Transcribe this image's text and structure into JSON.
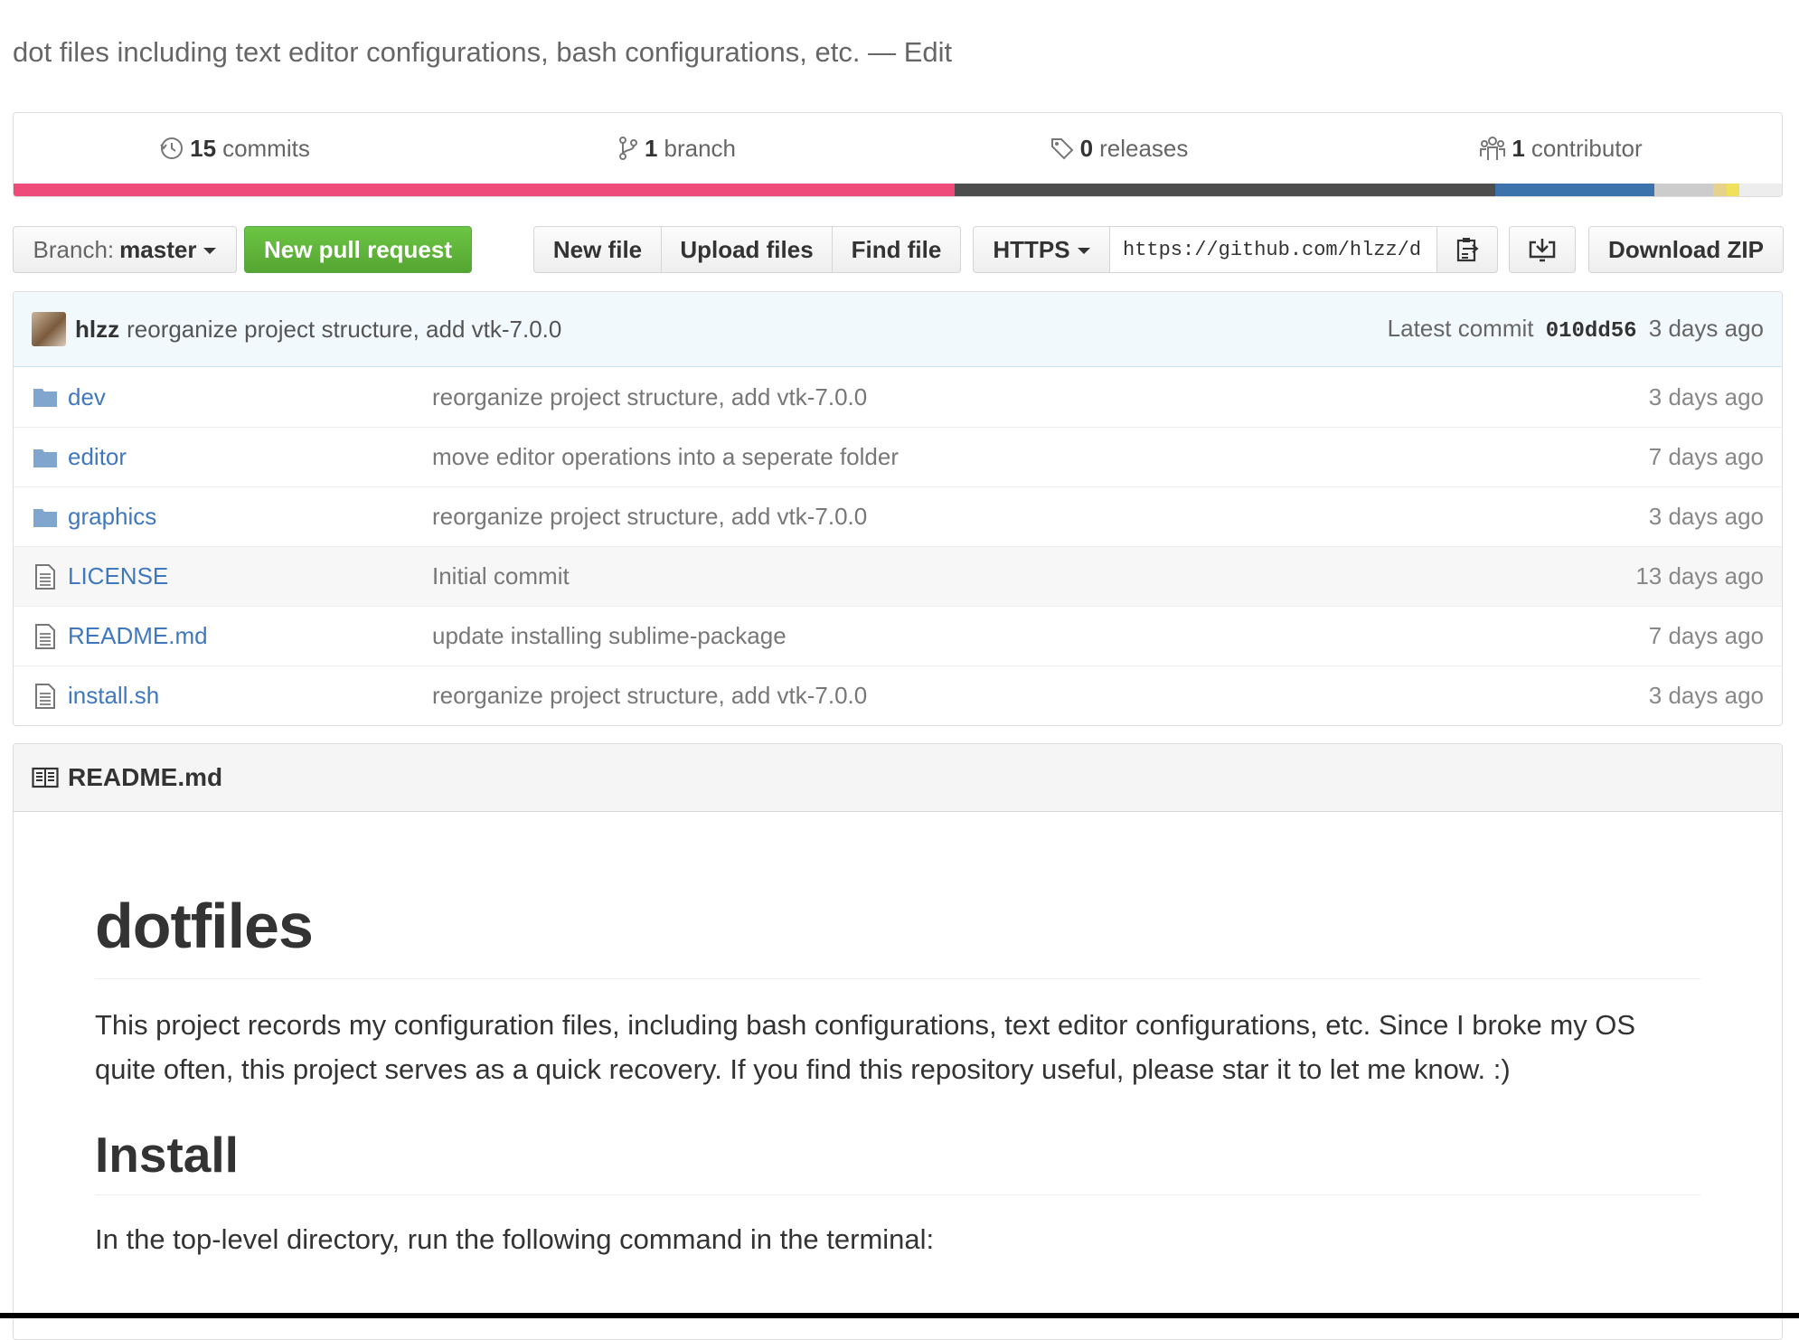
{
  "repo": {
    "description": "dot files including text editor configurations, bash configurations, etc.",
    "description_separator": "—",
    "edit_label": "Edit"
  },
  "summary": {
    "commits": {
      "count": "15",
      "label": "commits",
      "icon": "history-icon"
    },
    "branches": {
      "count": "1",
      "label": "branch",
      "icon": "git-branch-icon"
    },
    "releases": {
      "count": "0",
      "label": "releases",
      "icon": "tag-icon"
    },
    "contributors": {
      "count": "1",
      "label": "contributor",
      "icon": "organization-icon"
    }
  },
  "language_bar": [
    {
      "color": "#ee4b7a",
      "share": 53.2
    },
    {
      "color": "#4d4d4d",
      "share": 30.6
    },
    {
      "color": "#3d73ad",
      "share": 9.0
    },
    {
      "color": "#cccccc",
      "share": 3.3
    },
    {
      "color": "#e6d28a",
      "share": 0.8
    },
    {
      "color": "#f1e05a",
      "share": 0.7
    },
    {
      "color": "#ededed",
      "share": 2.4
    }
  ],
  "toolbar": {
    "branch_prefix": "Branch:",
    "branch_name": "master",
    "new_pull_request": "New pull request",
    "new_file": "New file",
    "upload_files": "Upload files",
    "find_file": "Find file",
    "protocol": "HTTPS",
    "clone_url": "https://github.com/hlzz/d",
    "download_zip": "Download ZIP"
  },
  "latest_commit": {
    "author": "hlzz",
    "message": "reorganize project structure, add vtk-7.0.0",
    "prefix": "Latest commit",
    "sha": "010dd56",
    "age": "3 days ago"
  },
  "files": [
    {
      "type": "dir",
      "name": "dev",
      "message": "reorganize project structure, add vtk-7.0.0",
      "age": "3 days ago"
    },
    {
      "type": "dir",
      "name": "editor",
      "message": "move editor operations into a seperate folder",
      "age": "7 days ago"
    },
    {
      "type": "dir",
      "name": "graphics",
      "message": "reorganize project structure, add vtk-7.0.0",
      "age": "3 days ago"
    },
    {
      "type": "file",
      "name": "LICENSE",
      "message": "Initial commit",
      "age": "13 days ago"
    },
    {
      "type": "file",
      "name": "README.md",
      "message": "update installing sublime-package",
      "age": "7 days ago"
    },
    {
      "type": "file",
      "name": "install.sh",
      "message": "reorganize project structure, add vtk-7.0.0",
      "age": "3 days ago"
    }
  ],
  "readme": {
    "filename": "README.md",
    "title": "dotfiles",
    "intro": "This project records my configuration files, including bash configurations, text editor configurations, etc. Since I broke my OS quite often, this project serves as a quick recovery. If you find this repository useful, please star it to let me know. :)",
    "install_heading": "Install",
    "install_text": "In the top-level directory, run the following command in the terminal:"
  }
}
